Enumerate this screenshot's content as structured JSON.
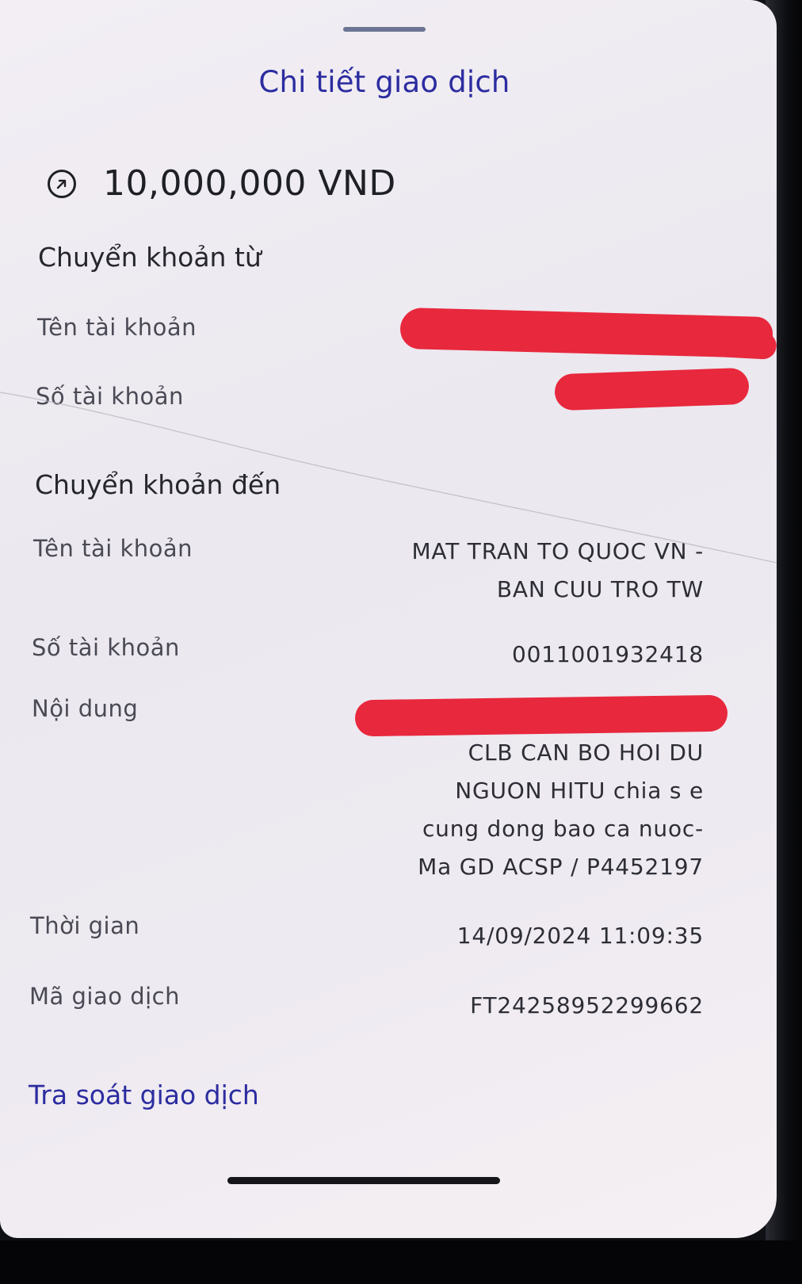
{
  "header": {
    "title": "Chi tiết giao dịch"
  },
  "amount": {
    "icon": "arrow-up-right-circle-icon",
    "text": "10,000,000 VND"
  },
  "from": {
    "section_title": "Chuyển khoản từ",
    "account_name_label": "Tên tài khoản",
    "account_number_label": "Số tài khoản"
  },
  "to": {
    "section_title": "Chuyển khoản đến",
    "account_name_label": "Tên tài khoản",
    "account_name_line1": "MAT TRAN TO QUOC VN -",
    "account_name_line2": "BAN CUU TRO TW",
    "account_number_label": "Số tài khoản",
    "account_number": "0011001932418",
    "content_label": "Nội dung",
    "content_lines": [
      "CLB CAN BO HOI DU",
      "NGUON HITU chia s e",
      "cung dong bao ca nuoc-",
      "Ma GD ACSP / P4452197"
    ],
    "time_label": "Thời gian",
    "time_value": "14/09/2024 11:09:35",
    "txn_id_label": "Mã giao dịch",
    "txn_id_value": "FT24258952299662"
  },
  "actions": {
    "inquiry_link": "Tra soát giao dịch"
  },
  "colors": {
    "accent": "#2c2ca0",
    "redaction": "#e8283d",
    "text": "#2d2d36"
  }
}
